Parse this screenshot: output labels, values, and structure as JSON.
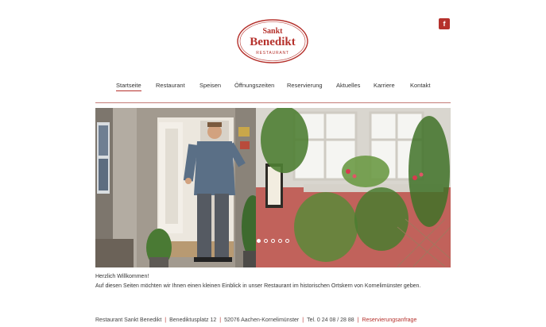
{
  "logo": {
    "line1": "Sankt",
    "line2": "Benedikt",
    "line3": "RESTAURANT"
  },
  "social": {
    "facebook_label": "f"
  },
  "nav": {
    "items": [
      {
        "label": "Startseite"
      },
      {
        "label": "Restaurant"
      },
      {
        "label": "Speisen"
      },
      {
        "label": "Öffnungszeiten"
      },
      {
        "label": "Reservierung"
      },
      {
        "label": "Aktuelles"
      },
      {
        "label": "Karriere"
      },
      {
        "label": "Kontakt"
      }
    ],
    "active_index": 0
  },
  "slider": {
    "slide_count": 5,
    "active_index": 0
  },
  "content": {
    "welcome": "Herzlich Willkommen!",
    "intro": "Auf diesen Seiten möchten wir Ihnen einen kleinen Einblick in unser Restaurant im historischen Ortskern von Kornelimünster geben."
  },
  "footer": {
    "name": "Restaurant Sankt Benedikt",
    "street": "Benediktusplatz 12",
    "city": "52076 Aachen-Kornelimünster",
    "phone": "Tel. 0 24 08 / 28 88",
    "reservation_link": "Reservierungsanfrage"
  },
  "colors": {
    "accent": "#b5312c"
  }
}
